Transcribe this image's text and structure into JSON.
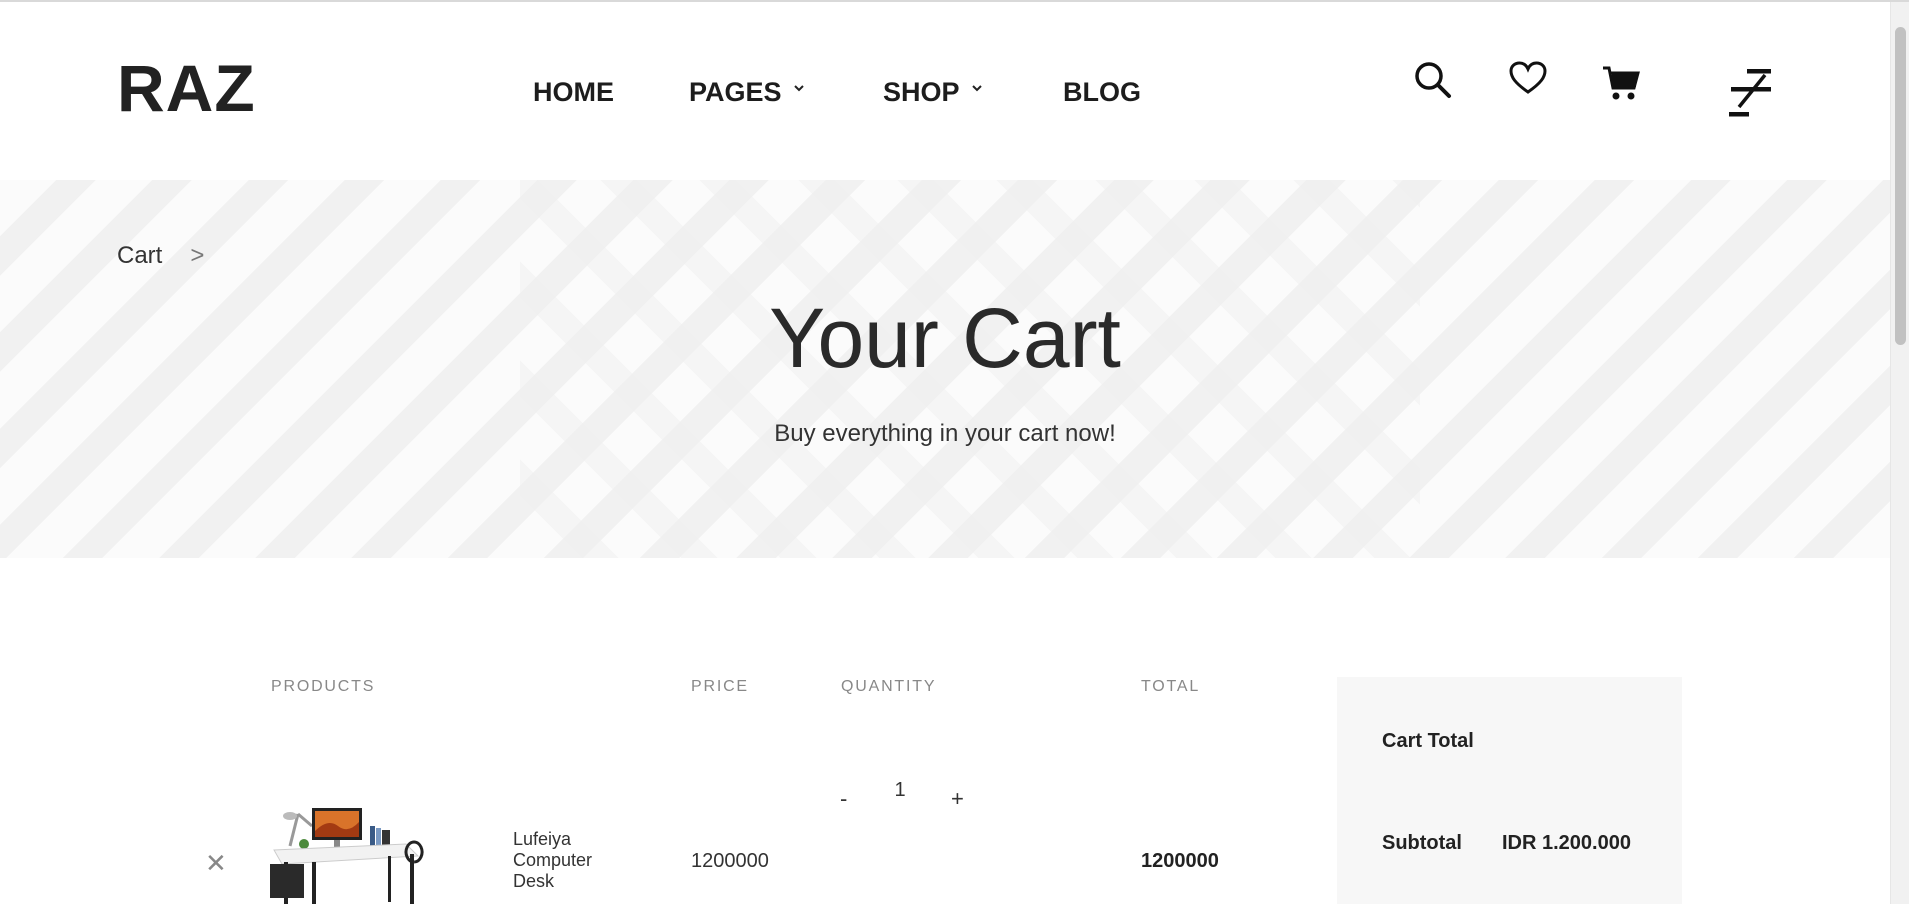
{
  "header": {
    "logo": "RAZ",
    "nav": [
      {
        "label": "HOME"
      },
      {
        "label": "PAGES",
        "has_dropdown": true
      },
      {
        "label": "SHOP",
        "has_dropdown": true
      },
      {
        "label": "BLOG"
      }
    ],
    "icons": [
      "search-icon",
      "heart-icon",
      "cart-icon",
      "menu-icon"
    ]
  },
  "hero": {
    "breadcrumb": {
      "label": "Cart",
      "separator": ">"
    },
    "title": "Your Cart",
    "subtitle": "Buy everything in your cart now!"
  },
  "cart": {
    "columns": {
      "products": "PRODUCTS",
      "price": "PRICE",
      "quantity": "QUANTITY",
      "total": "TOTAL"
    },
    "items": [
      {
        "remove_symbol": "✕",
        "name": "Lufeiya Computer Desk",
        "price": "1200000",
        "quantity": "1",
        "qty_minus": "-",
        "qty_plus": "+",
        "total": "1200000"
      }
    ]
  },
  "summary": {
    "title": "Cart Total",
    "subtotal_label": "Subtotal",
    "subtotal_value": "IDR 1.200.000"
  },
  "colors": {
    "text": "#222222",
    "muted": "#888888",
    "hero_bg": "#fbfbfb",
    "stripe": "#f1f1f1",
    "summary_bg": "#f7f7f7"
  }
}
